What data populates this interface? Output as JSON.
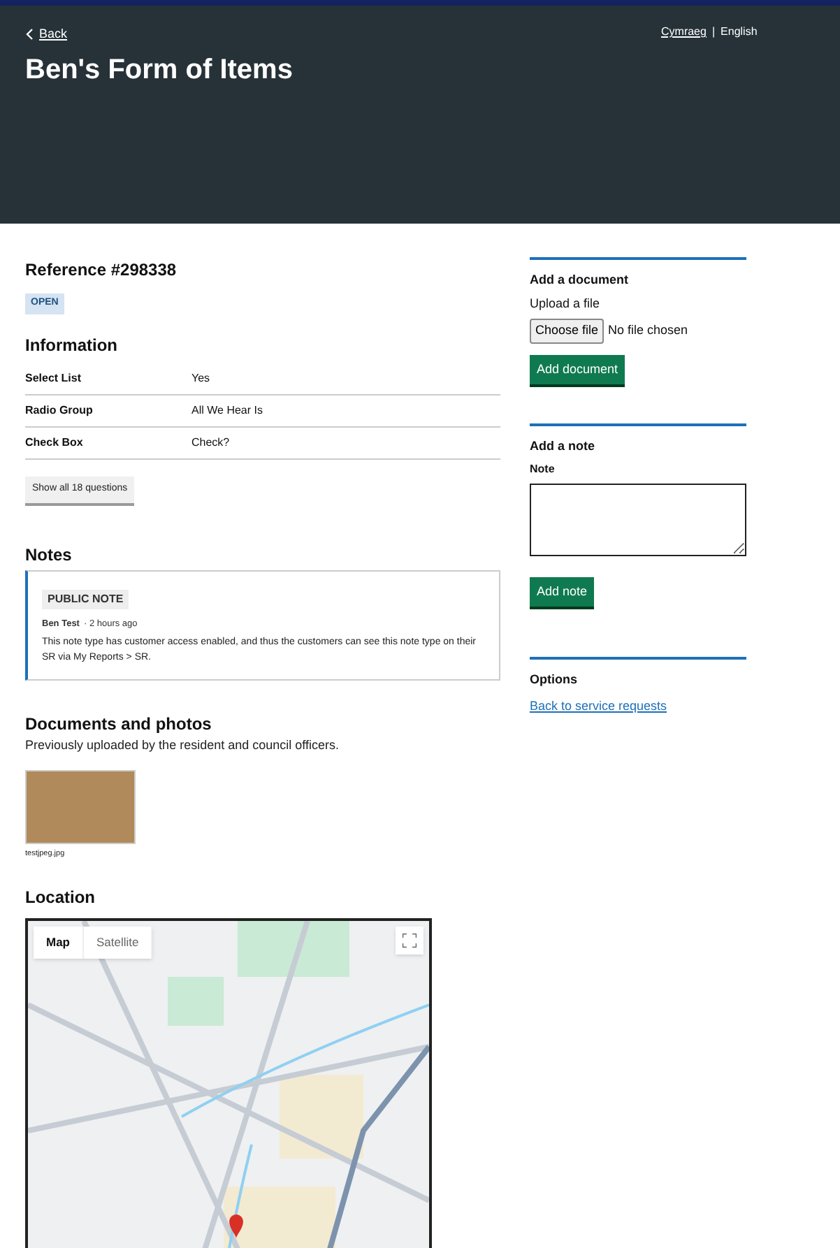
{
  "header": {
    "back_link": "Back",
    "title": "Ben's Form of Items",
    "languages": [
      {
        "label": "Cymraeg",
        "selected": false
      },
      {
        "label": "English",
        "selected": true
      }
    ],
    "separator": "|"
  },
  "reference": {
    "title": "Reference #298338",
    "status": "OPEN"
  },
  "information": {
    "heading": "Information",
    "rows": [
      {
        "label": "Select List",
        "value": "Yes"
      },
      {
        "label": "Radio Group",
        "value": "All We Hear Is"
      },
      {
        "label": "Check Box",
        "value": "Check?"
      }
    ],
    "show_all_button": "Show all 18 questions"
  },
  "notes": {
    "heading": "Notes",
    "items": [
      {
        "tag": "PUBLIC NOTE",
        "author": "Ben Test",
        "time": "· 2 hours ago",
        "text": "This note type has customer access enabled, and thus the customers can see this note type on their SR via My Reports > SR."
      }
    ]
  },
  "documents": {
    "heading": "Documents and photos",
    "description": "Previously uploaded by the resident and council officers.",
    "files": [
      {
        "name": "testjpeg.jpg"
      }
    ]
  },
  "location": {
    "heading": "Location",
    "map_types": [
      {
        "label": "Map",
        "selected": true
      },
      {
        "label": "Satellite",
        "selected": false
      }
    ]
  },
  "add_document": {
    "heading": "Add a document",
    "label": "Upload a file",
    "choose_button": "Choose file",
    "file_status": "No file chosen",
    "submit": "Add document"
  },
  "add_note": {
    "heading": "Add a note",
    "label": "Note",
    "submit": "Add note"
  },
  "options": {
    "heading": "Options",
    "links": [
      "Back to service requests"
    ]
  }
}
